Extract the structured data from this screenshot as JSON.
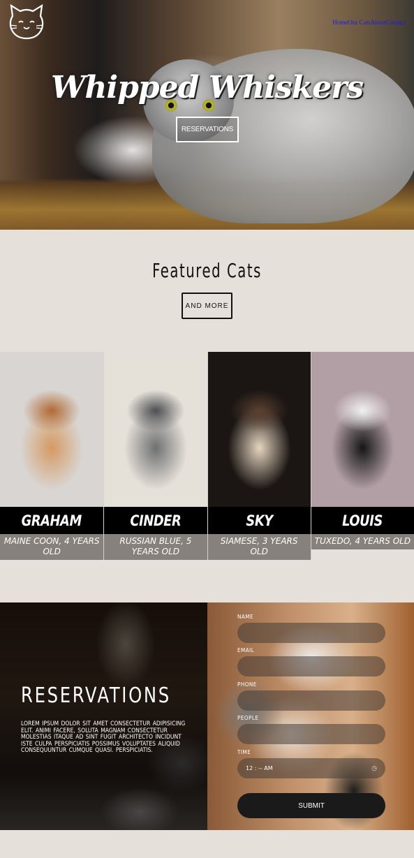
{
  "site": {
    "title": "Whipped Whiskers",
    "nav": [
      "Home",
      "Our Cats",
      "About",
      "Contact"
    ],
    "hero_button": "Reservations"
  },
  "featured": {
    "heading": "Featured Cats",
    "more_button": "And More",
    "cats": [
      {
        "name": "Graham",
        "desc": "Maine Coon, 4 Years Old",
        "colors": [
          "#d9d5d2",
          "#d59a62",
          "#b06a34"
        ]
      },
      {
        "name": "Cinder",
        "desc": "Russian Blue, 5 Years Old",
        "colors": [
          "#e5e0d8",
          "#6e7072",
          "#4c4e52"
        ]
      },
      {
        "name": "Sky",
        "desc": "Siamese, 3 Years Old",
        "colors": [
          "#1b1614",
          "#e6d6c0",
          "#5c4030"
        ]
      },
      {
        "name": "Louis",
        "desc": "Tuxedo, 4 Years Old",
        "colors": [
          "#b29fa6",
          "#161616",
          "#f2f2f2"
        ]
      }
    ]
  },
  "reservations": {
    "title": "Reservations",
    "text": "Lorem ipsum dolor sit amet consectetur adipisicing elit. Animi facere, soluta magnam consectetur molestias itaque ad sint fugit architecto incidunt iste culpa perspiciatis possimus voluptates aliquid consequuntur cumque quasi. perspiciatis.",
    "fields": [
      {
        "label": "Name",
        "value": ""
      },
      {
        "label": "Email",
        "value": ""
      },
      {
        "label": "Phone",
        "value": ""
      },
      {
        "label": "People",
        "value": ""
      },
      {
        "label": "Time",
        "value": "12 : -- AM"
      }
    ],
    "submit": "Submit"
  }
}
